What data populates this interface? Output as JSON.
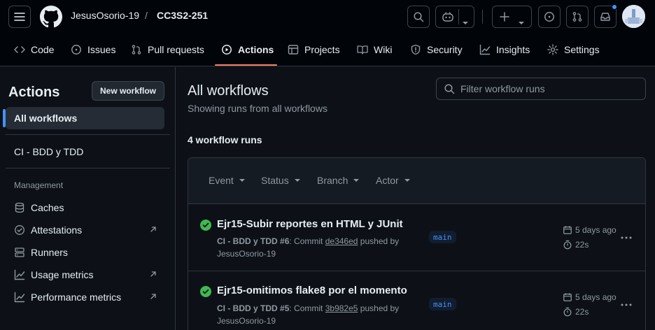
{
  "header": {
    "owner": "JesusOsorio-19",
    "separator": "/",
    "repo": "CC3S2-251"
  },
  "tabs": [
    {
      "label": "Code",
      "icon": "code-icon"
    },
    {
      "label": "Issues",
      "icon": "issue-icon"
    },
    {
      "label": "Pull requests",
      "icon": "pull-request-icon"
    },
    {
      "label": "Actions",
      "icon": "play-icon",
      "active": true
    },
    {
      "label": "Projects",
      "icon": "table-icon"
    },
    {
      "label": "Wiki",
      "icon": "book-icon"
    },
    {
      "label": "Security",
      "icon": "shield-icon"
    },
    {
      "label": "Insights",
      "icon": "graph-icon"
    },
    {
      "label": "Settings",
      "icon": "gear-icon"
    }
  ],
  "sidebar": {
    "title": "Actions",
    "new_workflow": "New workflow",
    "all_workflows": "All workflows",
    "workflows": [
      "CI - BDD y TDD"
    ],
    "management_label": "Management",
    "management": [
      {
        "label": "Caches",
        "icon": "database-icon"
      },
      {
        "label": "Attestations",
        "icon": "verified-icon",
        "external": true
      },
      {
        "label": "Runners",
        "icon": "server-icon"
      },
      {
        "label": "Usage metrics",
        "icon": "graph-icon",
        "external": true
      },
      {
        "label": "Performance metrics",
        "icon": "graph-icon",
        "external": true
      }
    ]
  },
  "main": {
    "title": "All workflows",
    "subtitle": "Showing runs from all workflows",
    "filter_placeholder": "Filter workflow runs",
    "run_count": "4 workflow runs",
    "filters": [
      "Event",
      "Status",
      "Branch",
      "Actor"
    ],
    "runs": [
      {
        "title": "Ejr15-Subir reportes en HTML y JUnit",
        "workflow": "CI - BDD y TDD",
        "run_number": "#6",
        "commit_label": "Commit",
        "sha": "de346ed",
        "pushed_by": "pushed by",
        "author": "JesusOsorio-19",
        "branch": "main",
        "date": "5 days ago",
        "duration": "22s",
        "status": "success"
      },
      {
        "title": "Ejr15-omitimos flake8 por el momento",
        "workflow": "CI - BDD y TDD",
        "run_number": "#5",
        "commit_label": "Commit",
        "sha": "3b982e5",
        "pushed_by": "pushed by",
        "author": "JesusOsorio-19",
        "branch": "main",
        "date": "5 days ago",
        "duration": "22s",
        "status": "success"
      }
    ]
  },
  "colors": {
    "background": "#0d1117",
    "header_bg": "#010409",
    "accent_blue": "#4493f8",
    "active_tab_underline": "#f78166",
    "success_green": "#3fb950",
    "muted_text": "#9198a1"
  }
}
